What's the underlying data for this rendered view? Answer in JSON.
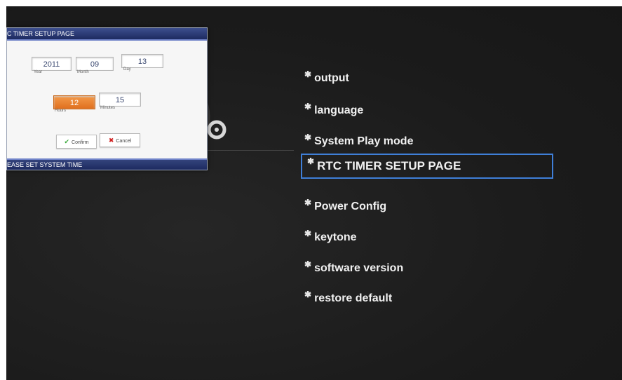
{
  "dialog": {
    "title": "C TIMER SETUP PAGE",
    "footer": "EASE SET SYSTEM TIME",
    "fields": {
      "year": {
        "value": "2011",
        "label": "Year"
      },
      "month": {
        "value": "09",
        "label": "Month"
      },
      "day": {
        "value": "13",
        "label": "Day"
      },
      "hours": {
        "value": "12",
        "label": "Hours"
      },
      "minutes": {
        "value": "15",
        "label": "Minutes"
      }
    },
    "confirm_label": "Confirm",
    "cancel_label": "Cancel"
  },
  "menu": {
    "items": [
      {
        "label": "output",
        "icon": "gear-icon"
      },
      {
        "label": "language",
        "icon": "gear-icon"
      },
      {
        "label": "System Play mode",
        "icon": "gear-icon"
      },
      {
        "label": "RTC TIMER SETUP PAGE",
        "icon": "gear-icon",
        "selected": true
      },
      {
        "label": "Power Config",
        "icon": "gear-icon"
      },
      {
        "label": "keytone",
        "icon": "gear-icon"
      },
      {
        "label": "software version",
        "icon": "gear-icon"
      },
      {
        "label": "restore default",
        "icon": "gear-icon"
      }
    ]
  },
  "colors": {
    "selection_border": "#3f7fd8",
    "active_field": "#e0701e",
    "background": "#1c1c1c"
  }
}
